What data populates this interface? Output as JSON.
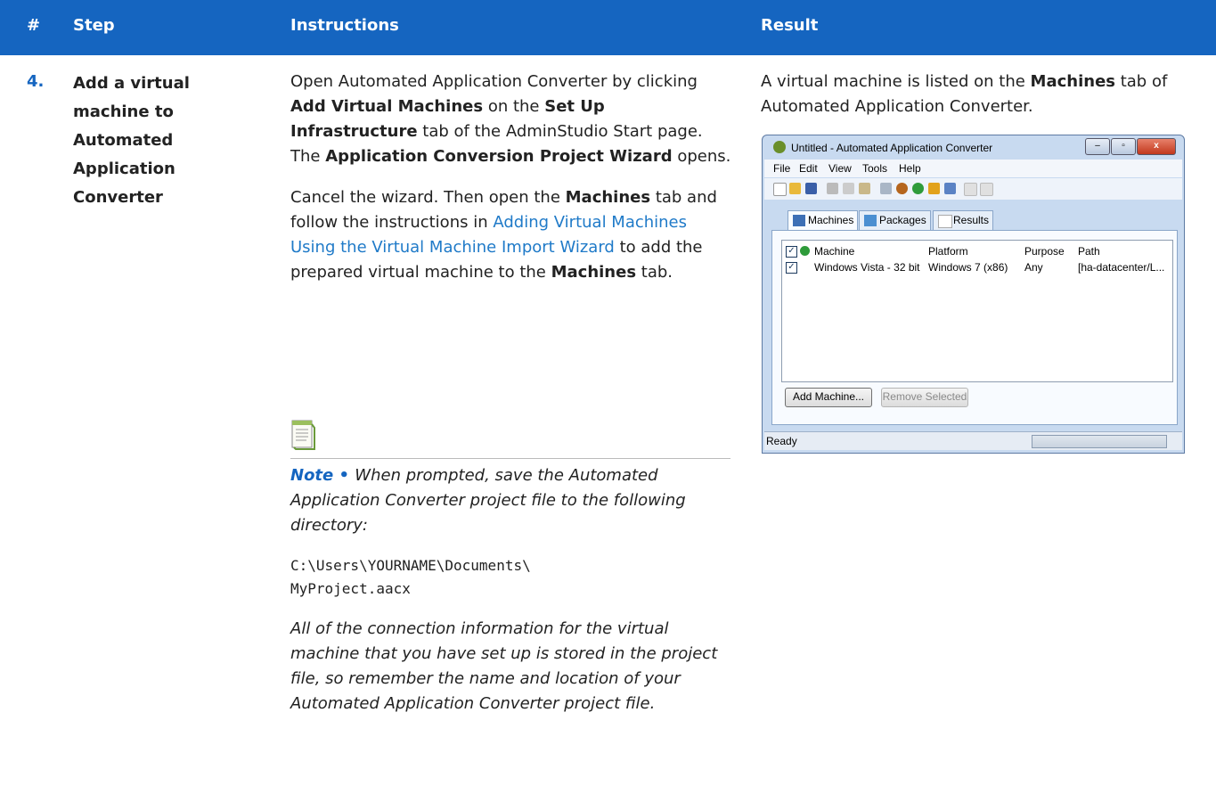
{
  "header": {
    "col_num": "#",
    "col_step": "Step",
    "col_instructions": "Instructions",
    "col_result": "Result"
  },
  "row": {
    "number": "4.",
    "step_lines": [
      "Add a virtual",
      "machine to",
      "Automated",
      "Application",
      "Converter"
    ],
    "instr_p1": {
      "t1": "Open Automated Application Converter by clicking ",
      "b1": "Add Virtual Machines",
      "t2": " on the ",
      "b2": "Set Up Infrastructure",
      "t3": " tab of the AdminStudio Start page. The ",
      "b3": "Application Conversion Project Wizard",
      "t4": " opens."
    },
    "instr_p2": {
      "t1": "Cancel the wizard. Then open the ",
      "b1": "Machines",
      "t2": " tab and follow the instructions in ",
      "link": "Adding Virtual Machines Using the Virtual Machine Import Wizard",
      "t3": " to add the prepared virtual machine to the ",
      "b2": "Machines",
      "t4": " tab."
    },
    "note": {
      "label": "Note",
      "sep": " • ",
      "text1": "When prompted, save the Automated Application Converter project file to the following directory:",
      "code_line1": "C:\\Users\\YOURNAME\\Documents\\",
      "code_line2": "MyProject.aacx",
      "text2": "All of the connection information for the virtual machine that you have set up is stored in the project file, so remember the name and location of your Automated Application Converter project file."
    },
    "result": {
      "t1": "A virtual machine is listed on the ",
      "b1": "Machines",
      "t2": " tab of Automated Application Converter."
    }
  },
  "screenshot": {
    "title": "Untitled - Automated Application Converter",
    "menu": [
      "File",
      "Edit",
      "View",
      "Tools",
      "Help"
    ],
    "tabs": [
      "Machines",
      "Packages",
      "Results"
    ],
    "columns": [
      "Machine",
      "Platform",
      "Purpose",
      "Path"
    ],
    "rows": [
      {
        "machine": "Windows Vista - 32 bit",
        "platform": "Windows 7 (x86)",
        "purpose": "Any",
        "path": "[ha-datacenter/L..."
      }
    ],
    "btn_add": "Add Machine...",
    "btn_remove": "Remove Selected",
    "status": "Ready",
    "win_min": "–",
    "win_max": "▫",
    "win_close": "x"
  }
}
